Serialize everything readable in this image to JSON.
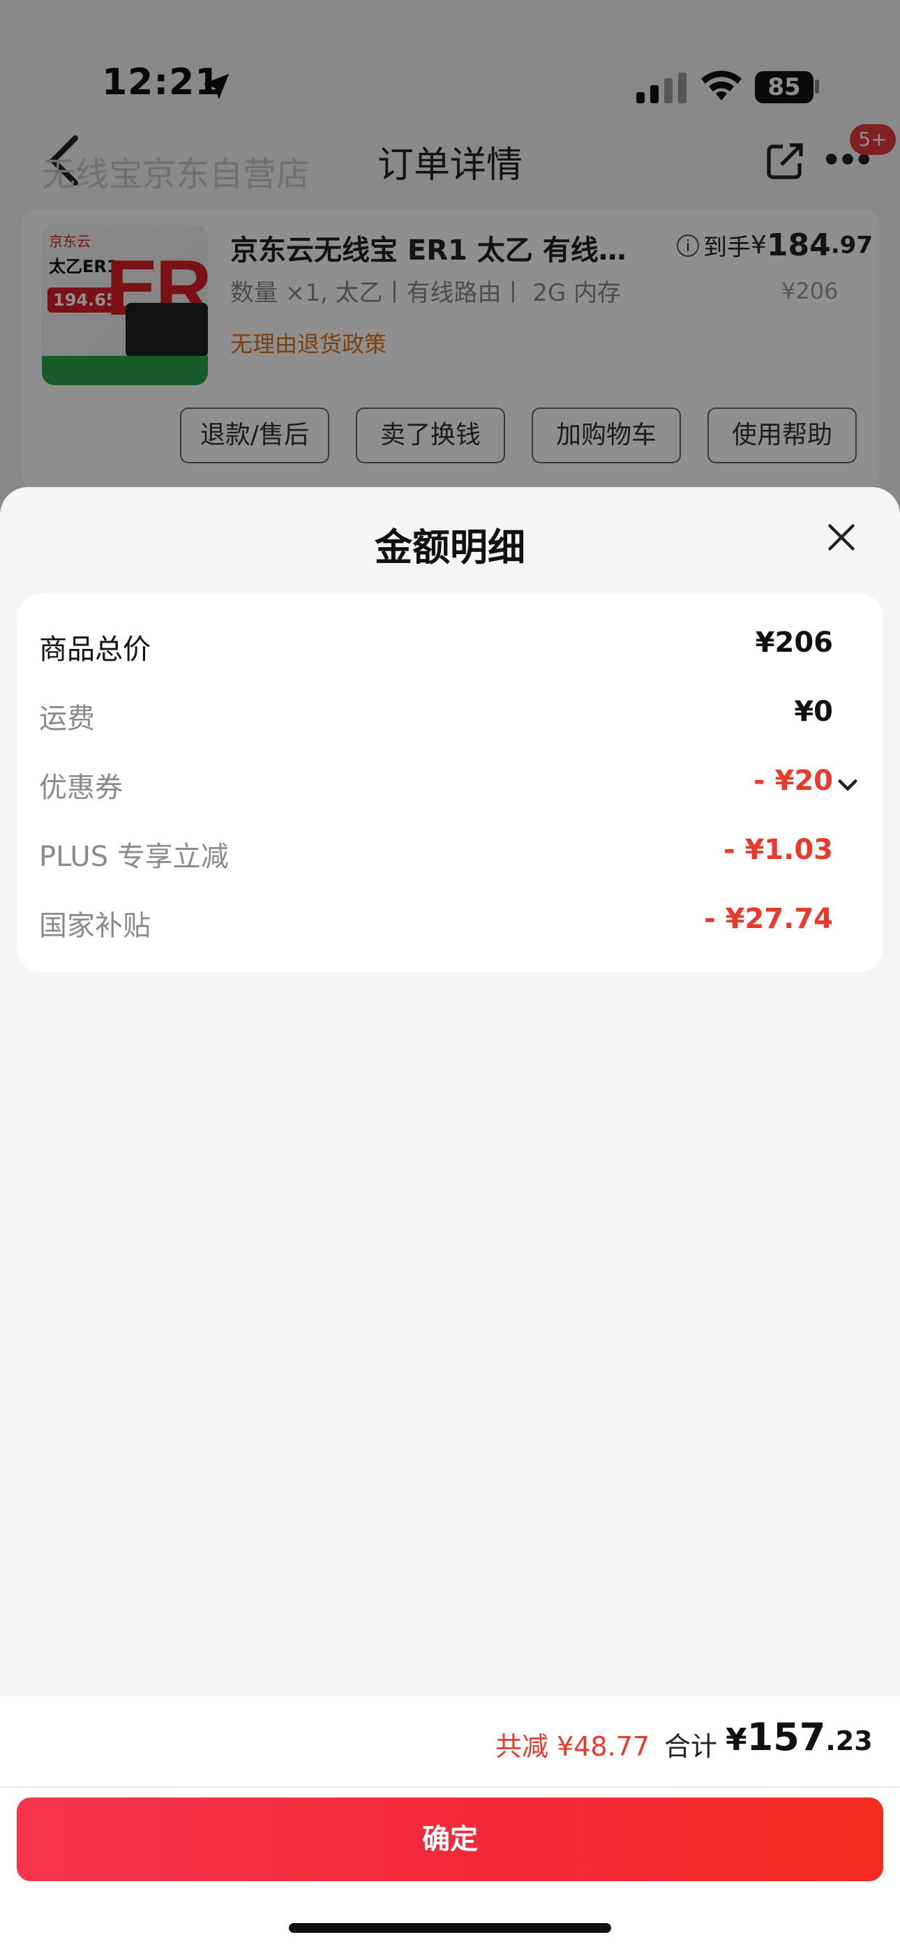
{
  "status_bar": {
    "time": "12:21",
    "battery": "85"
  },
  "bg_header_line": "…",
  "nav": {
    "title": "订单详情",
    "shadow_text": "无线宝京东自营店",
    "badge": "5+"
  },
  "product": {
    "title": "京东云无线宝 ER1 太乙 有线…",
    "subtitle": "数量 ×1, 太乙丨有线路由丨 2G 内存",
    "policy": "无理由退货政策",
    "price_label": "到手",
    "price_currency": "¥",
    "price_int": "184",
    "price_dec": ".97",
    "original_price": "¥206",
    "thumb": {
      "logo": "京东云",
      "brand": "太乙ER1",
      "price_tag": "194.65",
      "model": "ER1"
    }
  },
  "actions": [
    "退款/售后",
    "卖了换钱",
    "加购物车",
    "使用帮助"
  ],
  "sheet": {
    "title": "金额明细",
    "rows": [
      {
        "label": "商品总价",
        "value": "¥206"
      },
      {
        "label": "运费",
        "value": "¥0"
      },
      {
        "label": "优惠券",
        "value": "- ¥20"
      },
      {
        "label": "PLUS 专享立减",
        "value": "- ¥1.03"
      },
      {
        "label": "国家补贴",
        "value": "- ¥27.74"
      }
    ],
    "reduce_label": "共减 ¥48.77",
    "total_label": "合计",
    "total_currency": "¥",
    "total_int": "157",
    "total_dec": ".23",
    "confirm": "确定"
  },
  "colors": {
    "accent_red": "#e8392b",
    "button_start": "#f5364d",
    "button_end": "#f22b1f",
    "policy_orange": "#e0741a"
  }
}
